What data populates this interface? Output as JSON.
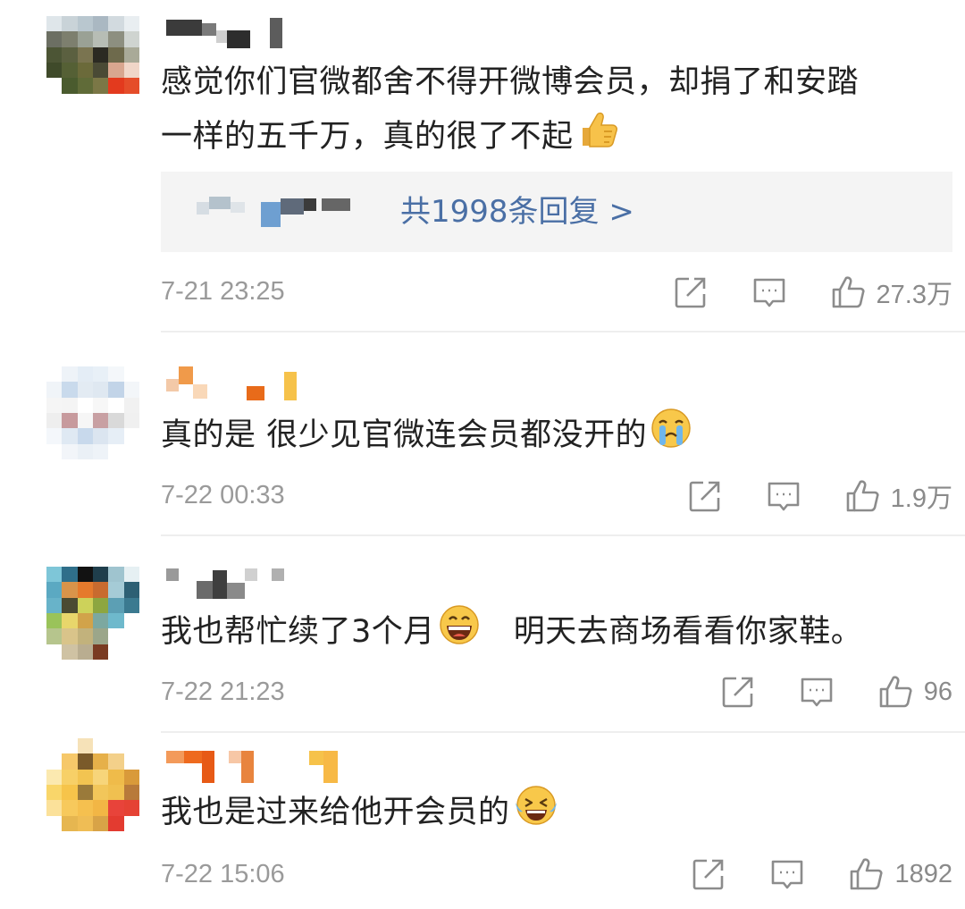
{
  "comments": [
    {
      "text_line1": "感觉你们官微都舍不得开微博会员，却捐了和安踏",
      "text_line2": "一样的五千万，真的很了不起",
      "emoji": "thumbs-up",
      "reply_link": "共1998条回复 >",
      "time": "7-21 23:25",
      "likes": "27.3万"
    },
    {
      "text": "真的是  很少见官微连会员都没开的",
      "emoji": "crying-face",
      "time": "7-22 00:33",
      "likes": "1.9万"
    },
    {
      "text_part1": "我也帮忙续了3个月",
      "text_part2": "明天去商场看看你家鞋。",
      "emoji": "grinning-face",
      "time": "7-22 21:23",
      "likes": "96"
    },
    {
      "text": "我也是过来给他开会员的",
      "emoji": "laughing-tears-face",
      "time": "7-22 15:06",
      "likes": "1892"
    }
  ],
  "icons": {
    "share": "share-icon",
    "comment": "comment-icon",
    "like": "thumbs-up-icon"
  },
  "colors": {
    "link": "#4a6fa5",
    "meta": "#9a9a9a",
    "text": "#222222"
  }
}
